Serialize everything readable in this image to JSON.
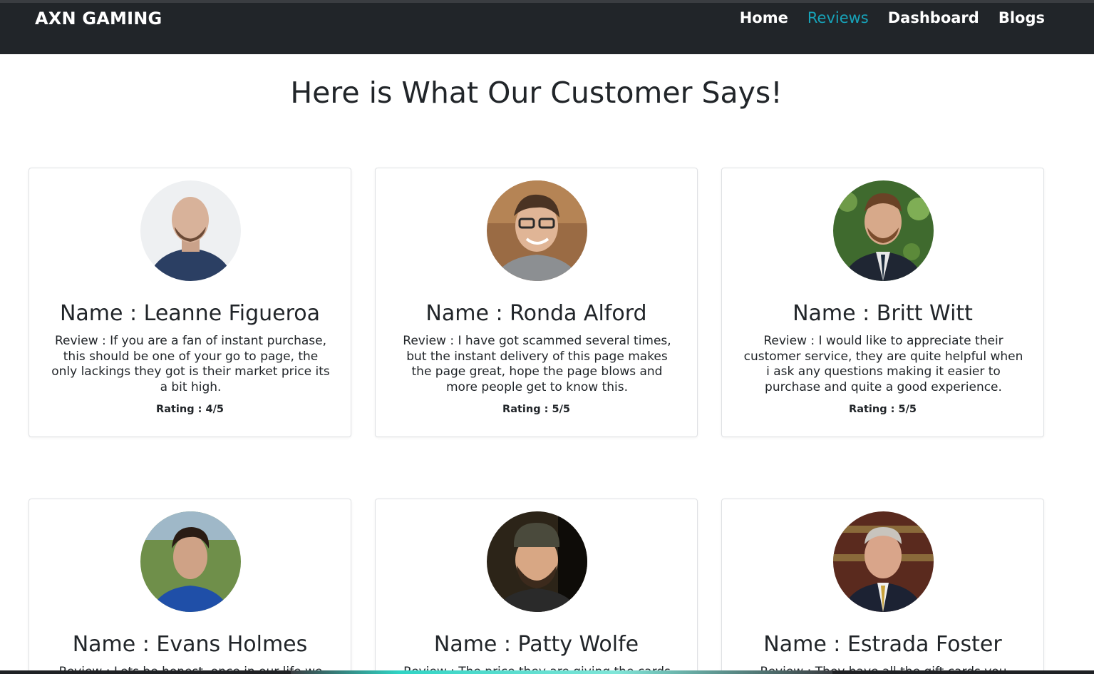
{
  "navbar": {
    "brand": "AXN GAMING",
    "links": [
      {
        "label": "Home",
        "active": false
      },
      {
        "label": "Reviews",
        "active": true
      },
      {
        "label": "Dashboard",
        "active": false
      },
      {
        "label": "Blogs",
        "active": false
      }
    ],
    "active_color": "#17a2b8"
  },
  "page": {
    "heading": "Here is What Our Customer Says!"
  },
  "reviews": [
    {
      "name": "Name : Leanne Figueroa",
      "review": "Review : If you are a fan of instant purchase, this should be one of your go to page, the only lackings they got is their market price its a bit high.",
      "rating": "Rating : 4/5"
    },
    {
      "name": "Name : Ronda Alford",
      "review": "Review : I have got scammed several times, but the instant delivery of this page makes the page great, hope the page blows and more people get to know this.",
      "rating": "Rating : 5/5"
    },
    {
      "name": "Name : Britt Witt",
      "review": "Review : I would like to appreciate their customer service, they are quite helpful when i ask any questions making it easier to purchase and quite a good experience.",
      "rating": "Rating : 5/5"
    },
    {
      "name": "Name : Evans Holmes",
      "review": "Review : Lets be honest, once in our life we got",
      "rating": ""
    },
    {
      "name": "Name : Patty Wolfe",
      "review": "Review : The price they are giving the cards at are",
      "rating": ""
    },
    {
      "name": "Name : Estrada Foster",
      "review": "Review : They have all the gift cards you would",
      "rating": ""
    }
  ]
}
